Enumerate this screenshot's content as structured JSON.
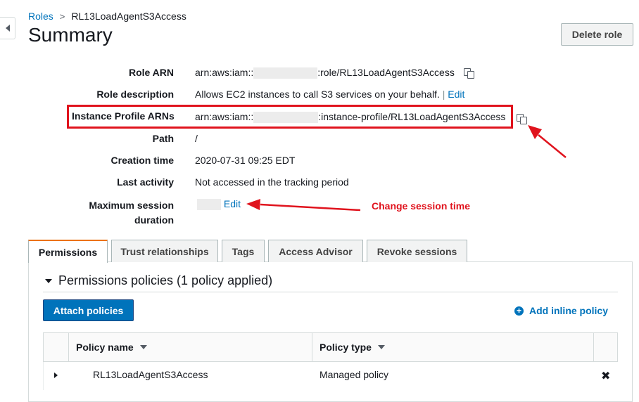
{
  "breadcrumb": {
    "root": "Roles",
    "separator": ">",
    "current": "RL13LoadAgentS3Access"
  },
  "page": {
    "title": "Summary",
    "delete_label": "Delete role"
  },
  "summary": {
    "role_arn": {
      "label": "Role ARN",
      "prefix": "arn:aws:iam::",
      "suffix": ":role/RL13LoadAgentS3Access"
    },
    "role_description": {
      "label": "Role description",
      "value": "Allows EC2 instances to call S3 services on your behalf.",
      "divider": "|",
      "edit": "Edit"
    },
    "instance_profile": {
      "label": "Instance Profile ARNs",
      "prefix": "arn:aws:iam::",
      "suffix": ":instance-profile/RL13LoadAgentS3Access"
    },
    "path": {
      "label": "Path",
      "value": "/"
    },
    "creation_time": {
      "label": "Creation time",
      "value": "2020-07-31 09:25 EDT"
    },
    "last_activity": {
      "label": "Last activity",
      "value": "Not accessed in the tracking period"
    },
    "max_session": {
      "label_line1": "Maximum session",
      "label_line2": "duration",
      "edit": "Edit"
    }
  },
  "annotation": {
    "text": "Change session time",
    "color": "#e0131d"
  },
  "tabs": [
    "Permissions",
    "Trust relationships",
    "Tags",
    "Access Advisor",
    "Revoke sessions"
  ],
  "permissions": {
    "heading": "Permissions policies (1 policy applied)",
    "attach_label": "Attach policies",
    "add_inline_label": "Add inline policy",
    "columns": [
      "Policy name",
      "Policy type"
    ],
    "rows": [
      {
        "name": "RL13LoadAgentS3Access",
        "type": "Managed policy",
        "remove": "✖"
      }
    ]
  },
  "colors": {
    "link": "#0073bb",
    "primary_button": "#0073bb",
    "active_tab_accent": "#ec7211"
  }
}
